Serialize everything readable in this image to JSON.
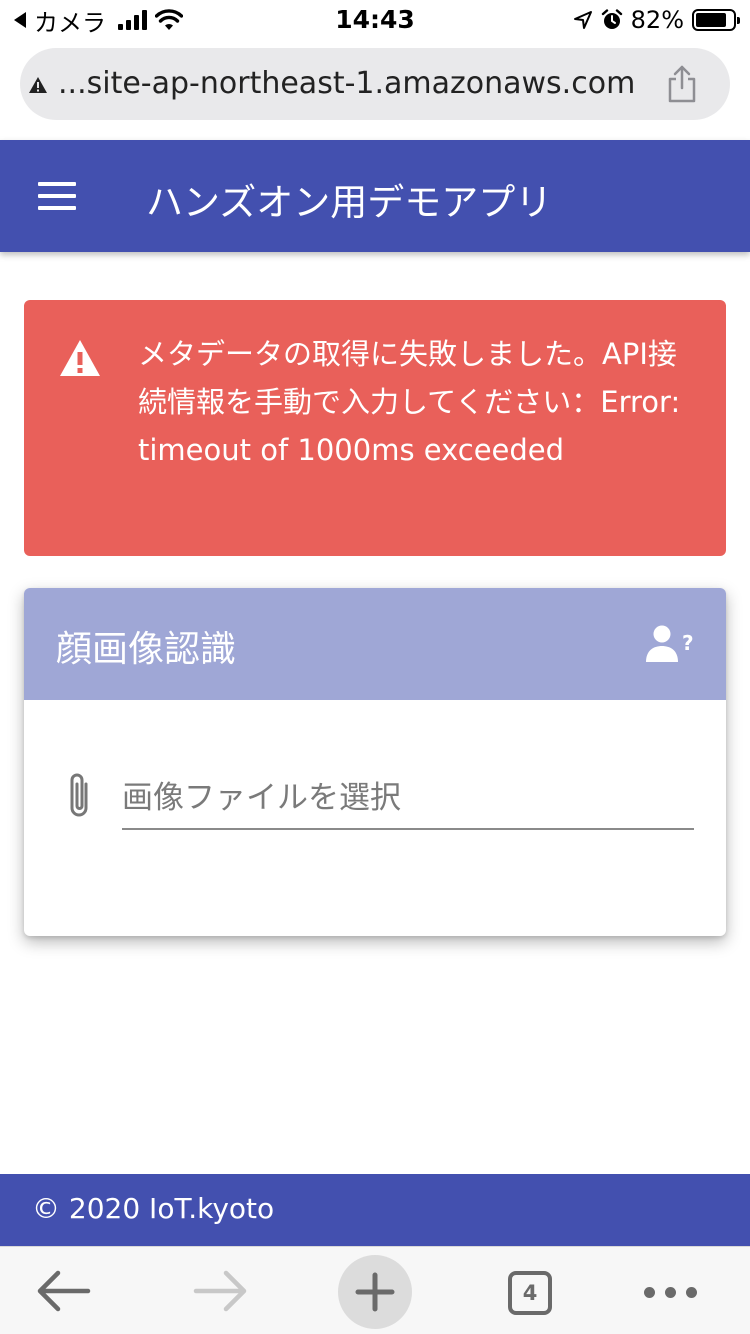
{
  "status_bar": {
    "back_label": "カメラ",
    "time": "14:43",
    "battery": "82%",
    "battery_level": 0.82,
    "icons": [
      "back-app-icon",
      "signal-icon",
      "wifi-icon",
      "location-icon",
      "alarm-icon",
      "battery-icon"
    ]
  },
  "browser": {
    "url": "...site-ap-northeast-1.amazonaws.com",
    "url_icons": [
      "warning-icon",
      "share-icon"
    ]
  },
  "app_bar": {
    "title": "ハンズオン用デモアプリ",
    "menu_icon": "hamburger-menu-icon"
  },
  "alert": {
    "icon": "warning-icon",
    "color": "#e9605a",
    "message": "メタデータの取得に失敗しました。API接続情報を手動で入力してください：Error: timeout of 1000ms exceeded"
  },
  "card": {
    "title": "顔画像認識",
    "header_color": "#9fa7d6",
    "header_icon": "person-question-icon",
    "file_input": {
      "icon": "paperclip-icon",
      "placeholder": "画像ファイルを選択"
    }
  },
  "footer": {
    "text": "© 2020 IoT.kyoto",
    "color": "#4350af"
  },
  "toolbar": {
    "tab_count": "4",
    "icons": [
      "back-arrow-icon",
      "forward-arrow-icon",
      "plus-icon",
      "tabs-icon",
      "more-dots-icon"
    ]
  },
  "colors": {
    "primary": "#4350af",
    "error": "#e9605a",
    "card_header": "#9fa7d6"
  }
}
